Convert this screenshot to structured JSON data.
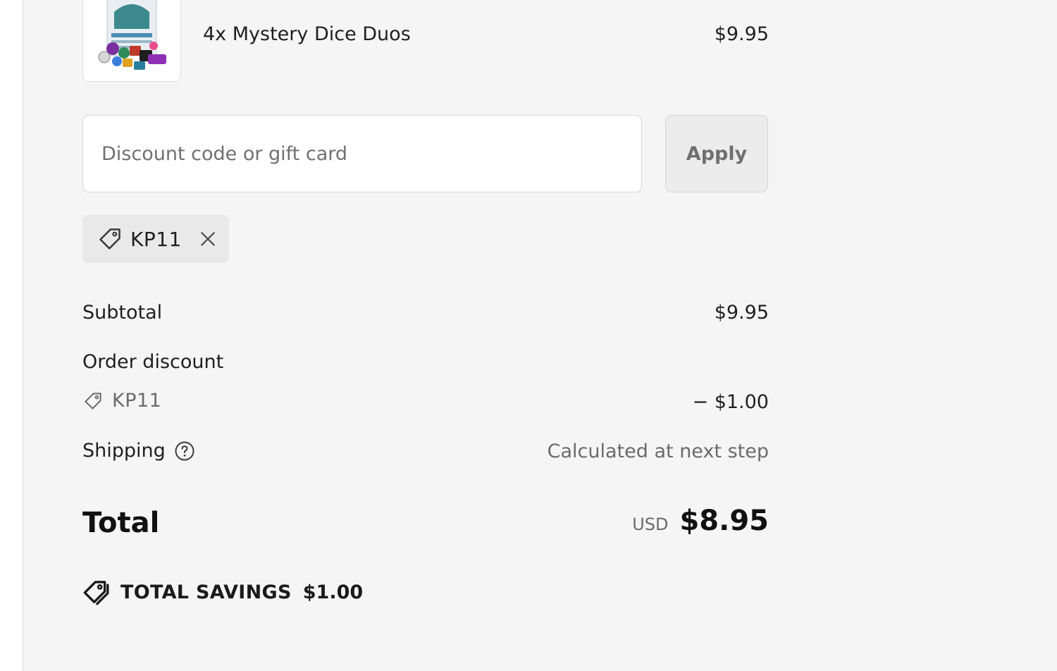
{
  "cart": {
    "items": [
      {
        "name": "4x Mystery Dice Duos",
        "price": "$9.95",
        "thumbnail_icon": "dice-product-image"
      }
    ]
  },
  "discount": {
    "placeholder": "Discount code or gift card",
    "value": "",
    "apply_label": "Apply",
    "applied_code": "KP11"
  },
  "summary": {
    "subtotal_label": "Subtotal",
    "subtotal_value": "$9.95",
    "order_discount_label": "Order discount",
    "order_discount_code": "KP11",
    "order_discount_value": "− $1.00",
    "shipping_label": "Shipping",
    "shipping_value": "Calculated at next step",
    "total_label": "Total",
    "currency": "USD",
    "total_value": "$8.95",
    "savings_label": "TOTAL SAVINGS",
    "savings_value": "$1.00"
  },
  "colors": {
    "panel_background": "#f5f5f5",
    "chip_background": "#e9e9e9",
    "muted_text": "#6b6b6b"
  }
}
